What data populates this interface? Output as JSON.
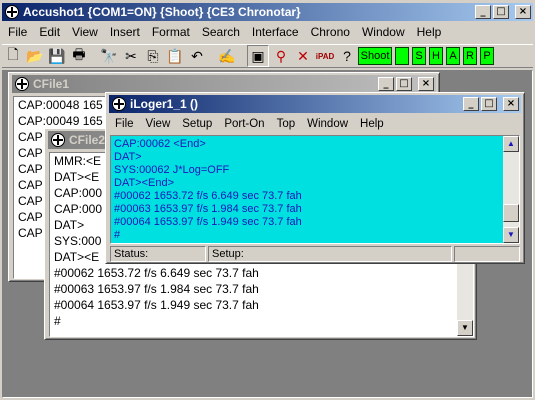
{
  "main_window": {
    "title": "Accushot1 {COM1=ON} {Shoot} {CE3 Chronotar}",
    "menu": [
      "File",
      "Edit",
      "View",
      "Insert",
      "Format",
      "Search",
      "Interface",
      "Chrono",
      "Window",
      "Help"
    ],
    "toolbar_buttons": {
      "shoot": "Shoot",
      "s": "S",
      "h": "H",
      "a": "A",
      "r": "R",
      "p": "P",
      "ipad": "iPAD"
    }
  },
  "cfile1": {
    "title": "CFile1",
    "lines": [
      "CAP:00048 165",
      "CAP:00049 165",
      "CAP",
      "CAP",
      "CAP",
      "CAP",
      "CAP",
      "CAP",
      "CAP"
    ]
  },
  "cfile2": {
    "title": "CFile2",
    "lines": [
      "MMR:<E",
      "DAT><E",
      "CAP:000",
      "CAP:000",
      "DAT>",
      "SYS:000",
      "DAT><E",
      "#00062 1653.72 f/s 6.649 sec 73.7 fah",
      "#00063 1653.97 f/s 1.984 sec 73.7 fah",
      "#00064 1653.97 f/s 1.949 sec 73.7 fah",
      "#"
    ]
  },
  "iloger": {
    "title": "iLoger1_1 ()",
    "menu": [
      "File",
      "View",
      "Setup",
      "Port-On",
      "Top",
      "Window",
      "Help"
    ],
    "lines": [
      "CAP:00062 <End>",
      "DAT>",
      "SYS:00062 J*Log=OFF",
      "DAT><End>",
      "#00062 1653.72 f/s 6.649 sec 73.7 fah",
      "#00063 1653.97 f/s 1.984 sec 73.7 fah",
      "#00064 1653.97 f/s 1.949 sec 73.7 fah",
      "#"
    ],
    "status_label": "Status:",
    "setup_label": "Setup:"
  },
  "colors": {
    "cyan_bg": "#00e0e0",
    "cyan_text": "#1b16b8",
    "green_btn": "#00ff00",
    "active_title": "#0a246a"
  }
}
